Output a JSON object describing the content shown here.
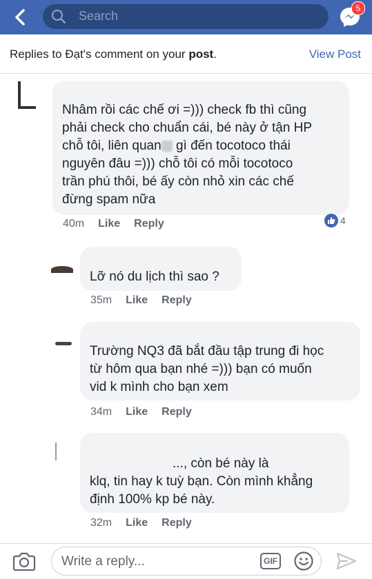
{
  "header": {
    "search_placeholder": "Search",
    "messenger_badge": "5"
  },
  "subheader": {
    "title_prefix": "Replies to Đạt's comment on your ",
    "title_bold": "post",
    "title_suffix": ".",
    "view_post": "View Post"
  },
  "comments": [
    {
      "lines": [
        "Nhâm rồi các chế ơi =))) check fb thì cũng",
        "phải check cho chuẩn cái, bé này ở tận HP",
        "chỗ tôi, liên quan",
        " gì đến tocotoco thái",
        "nguyên đâu =))) chỗ tôi có mỗi tocotoco",
        "trần phú thôi, bé ấy còn nhỏ xin các chế",
        "đừng spam nữa"
      ],
      "time": "40m",
      "like": "Like",
      "reply": "Reply",
      "reaction_count": "4"
    },
    {
      "lines": [
        "Lỡ nó du lịch thì sao ?"
      ],
      "time": "35m",
      "like": "Like",
      "reply": "Reply"
    },
    {
      "lines": [
        "Trường NQ3 đã bắt đầu tập trung đi học",
        "từ hôm qua bạn nhé =))) bạn có muốn",
        "vid k mình cho bạn xem"
      ],
      "time": "34m",
      "like": "Like",
      "reply": "Reply"
    },
    {
      "lines": [
        "..., còn bé này là",
        "klq, tin hay k tuỳ bạn. Còn mình khẳng",
        "định 100% kp bé này."
      ],
      "time": "32m",
      "like": "Like",
      "reply": "Reply"
    }
  ],
  "footer": {
    "reply_placeholder": "Write a reply...",
    "gif_label": "GIF"
  },
  "colors": {
    "brand": "#4267b2",
    "bubble": "#f2f3f5",
    "meta": "#606770"
  }
}
